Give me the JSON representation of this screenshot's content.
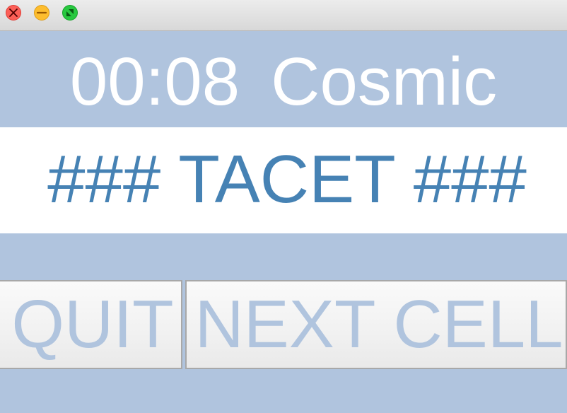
{
  "titlebar": {
    "close_icon": "close-icon",
    "minimize_icon": "minimize-icon",
    "maximize_icon": "maximize-icon"
  },
  "header": {
    "timer": "00:08",
    "title": "Cosmic"
  },
  "status": {
    "text": "### TACET ###"
  },
  "buttons": {
    "quit_label": "QUIT",
    "next_label": "NEXT CELL"
  },
  "colors": {
    "background": "#b0c4de",
    "status_text": "#4682b4",
    "header_text": "#ffffff",
    "button_text": "#b0c4de"
  }
}
